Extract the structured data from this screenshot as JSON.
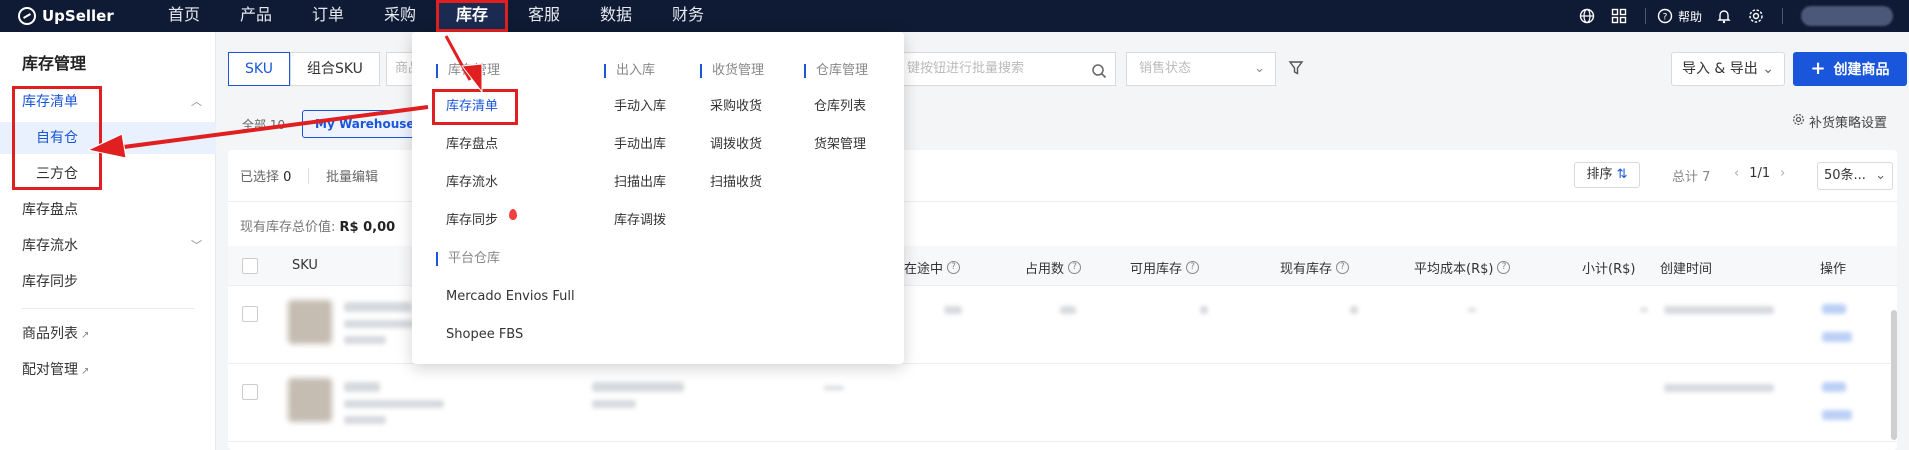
{
  "app": {
    "logo_text": "UpSeller"
  },
  "topnav": {
    "items": [
      "首页",
      "产品",
      "订单",
      "采购",
      "库存",
      "客服",
      "数据",
      "财务"
    ],
    "active_index": 4,
    "help_label": "帮助",
    "icons": [
      "globe-icon",
      "grid-icon",
      "help-icon",
      "bell-icon",
      "gear-icon"
    ]
  },
  "sidebar": {
    "title": "库存管理",
    "items": [
      {
        "label": "库存清单"
      },
      {
        "label": "自有仓"
      },
      {
        "label": "三方仓"
      },
      {
        "label": "库存盘点"
      },
      {
        "label": "库存流水"
      },
      {
        "label": "库存同步"
      },
      {
        "label": "商品列表"
      },
      {
        "label": "配对管理"
      }
    ]
  },
  "toolbar": {
    "tab_sku": "SKU",
    "tab_combo": "组合SKU",
    "search_prefix_placeholder": "商品",
    "search_placeholder": "键按钮进行批量搜索",
    "sales_status_placeholder": "销售状态",
    "import_export": "导入 & 导出",
    "create_product": "创建商品"
  },
  "warehouse_filter": {
    "all_label": "全部",
    "all_count": "10",
    "chip_label": "My Warehouse",
    "restock_settings": "补货策略设置"
  },
  "list": {
    "selected_label": "已选择",
    "selected_count": "0",
    "batch_edit": "批量编辑",
    "sort_label": "排序",
    "total_label": "总计 7",
    "page": "1/1",
    "page_size": "50条...",
    "stock_value_label": "现有库存总价值:",
    "stock_value": "R$ 0,00",
    "columns": [
      "SKU",
      "在途中",
      "占用数",
      "可用库存",
      "现有库存",
      "平均成本(R$)",
      "小计(R$)",
      "创建时间",
      "操作"
    ]
  },
  "dropdown": {
    "inventory_mgmt": {
      "header": "库存管理",
      "items": [
        "库存清单",
        "库存盘点",
        "库存流水",
        "库存同步"
      ]
    },
    "platform_warehouse": {
      "header": "平台仓库",
      "items": [
        "Mercado Envios Full",
        "Shopee FBS"
      ]
    },
    "in_out": {
      "header": "出入库",
      "items": [
        "手动入库",
        "手动出库",
        "扫描出库",
        "库存调拨"
      ]
    },
    "receiving": {
      "header": "收货管理",
      "items": [
        "采购收货",
        "调拨收货",
        "扫描收货"
      ]
    },
    "warehouse_mgmt": {
      "header": "仓库管理",
      "items": [
        "仓库列表",
        "货架管理"
      ]
    }
  },
  "colors": {
    "accent": "#1a56db",
    "nav_bg": "#0f1b34",
    "highlight_red": "#e02020"
  }
}
